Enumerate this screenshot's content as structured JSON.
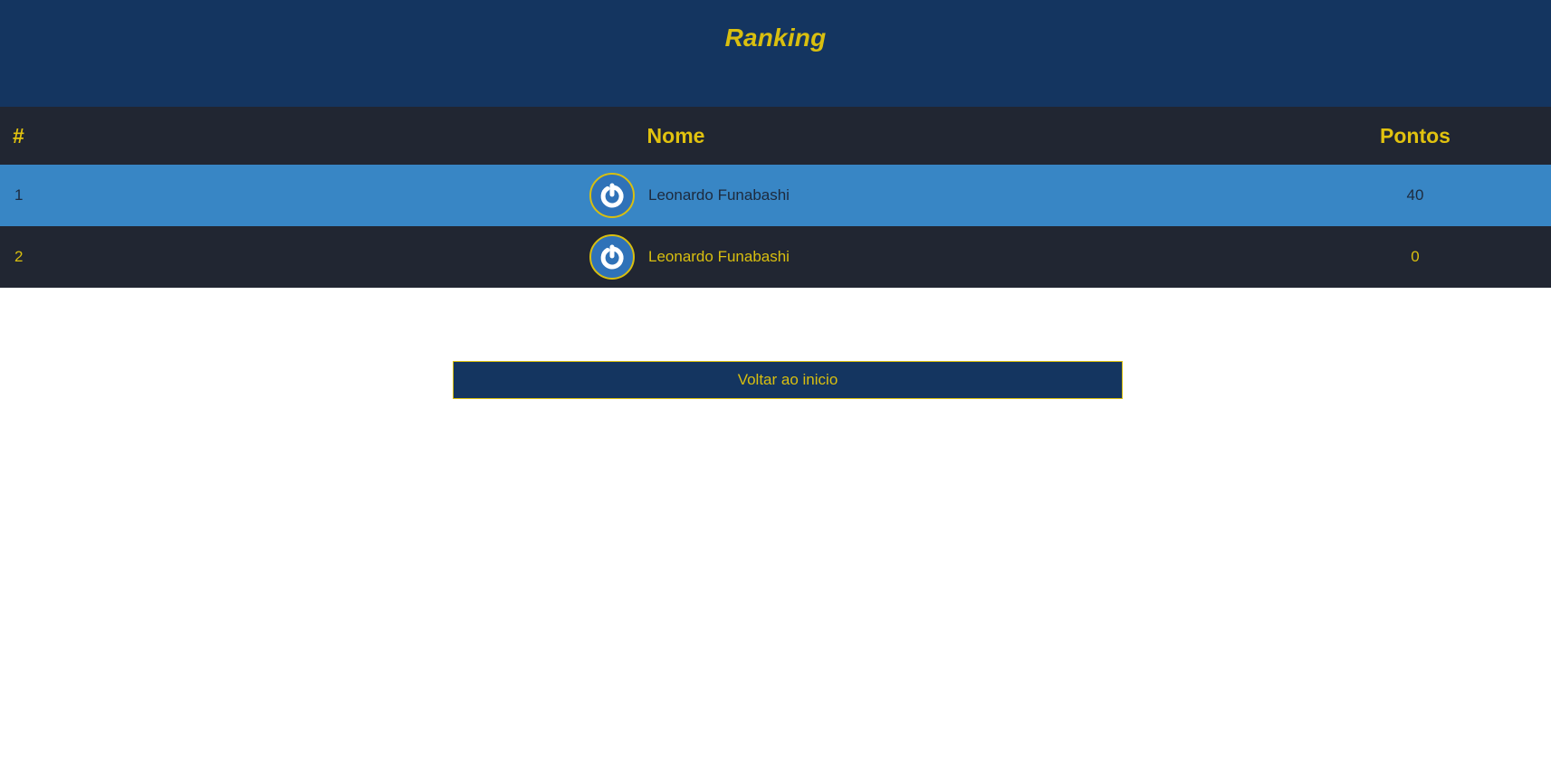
{
  "page": {
    "title": "Ranking"
  },
  "table": {
    "headers": {
      "rank": "#",
      "name": "Nome",
      "points": "Pontos"
    },
    "rows": [
      {
        "rank": "1",
        "avatar_icon": "power-icon",
        "name": "Leonardo Funabashi",
        "points": "40"
      },
      {
        "rank": "2",
        "avatar_icon": "power-icon",
        "name": "Leonardo Funabashi",
        "points": "0"
      }
    ]
  },
  "actions": {
    "back_label": "Voltar ao inicio"
  },
  "colors": {
    "header_bg": "#143560",
    "accent": "#d9bf0f",
    "table_dark": "#212632",
    "row_highlight": "#3886c5"
  }
}
